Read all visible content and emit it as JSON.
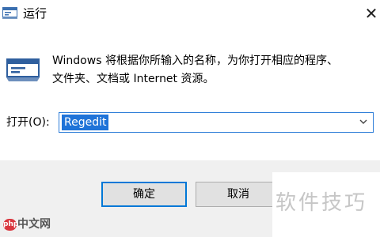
{
  "window": {
    "title": "运行",
    "close_glyph": "✕"
  },
  "description": {
    "line1": "Windows 将根据你所输入的名称，为你打开相应的程序、",
    "line2": "文件夹、文档或 Internet 资源。"
  },
  "open_field": {
    "label": "打开(O):",
    "value": "Regedit"
  },
  "buttons": {
    "ok_label": "确定",
    "cancel_label": "取消"
  },
  "watermark": {
    "text": "软件技巧",
    "logo_badge": "php",
    "logo_text": "中文网"
  },
  "icons": {
    "title": "run-icon",
    "dialog": "run-icon",
    "dropdown": "chevron-down-icon",
    "close": "close-icon"
  },
  "colors": {
    "accent": "#0078d7",
    "selection": "#1f73d8",
    "footer_bg": "#f0f0f0",
    "button_bg": "#e1e1e1"
  }
}
